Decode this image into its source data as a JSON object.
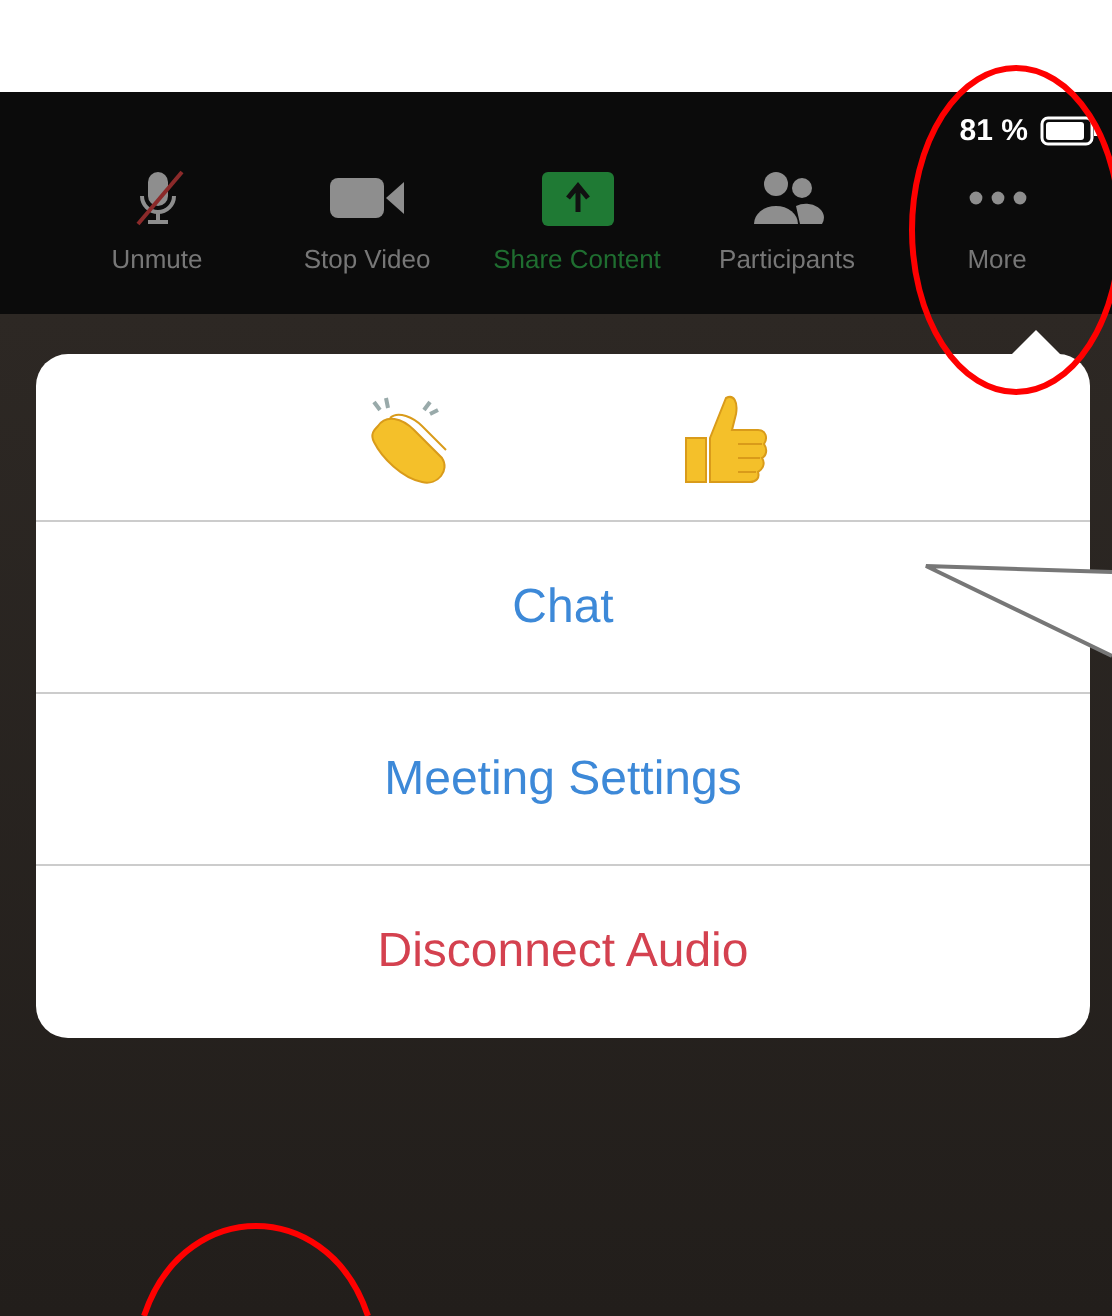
{
  "status_bar": {
    "battery": "81 %"
  },
  "toolbar": [
    {
      "label": "Unmute",
      "kind": "mic",
      "muted": true,
      "highlighted": false
    },
    {
      "label": "Stop Video",
      "kind": "video",
      "muted": false,
      "highlighted": false
    },
    {
      "label": "Share Content",
      "kind": "share",
      "muted": false,
      "highlighted": true
    },
    {
      "label": "Participants",
      "kind": "people",
      "muted": false,
      "highlighted": false
    },
    {
      "label": "More",
      "kind": "more",
      "muted": false,
      "highlighted": false
    }
  ],
  "menu": {
    "reactions": [
      {
        "kind": "clap"
      },
      {
        "kind": "thumbs_up"
      }
    ],
    "items": [
      {
        "label": "Chat",
        "kind": "normal"
      },
      {
        "label": "Meeting Settings",
        "kind": "normal"
      },
      {
        "label": "Disconnect Audio",
        "kind": "destructive"
      }
    ]
  }
}
